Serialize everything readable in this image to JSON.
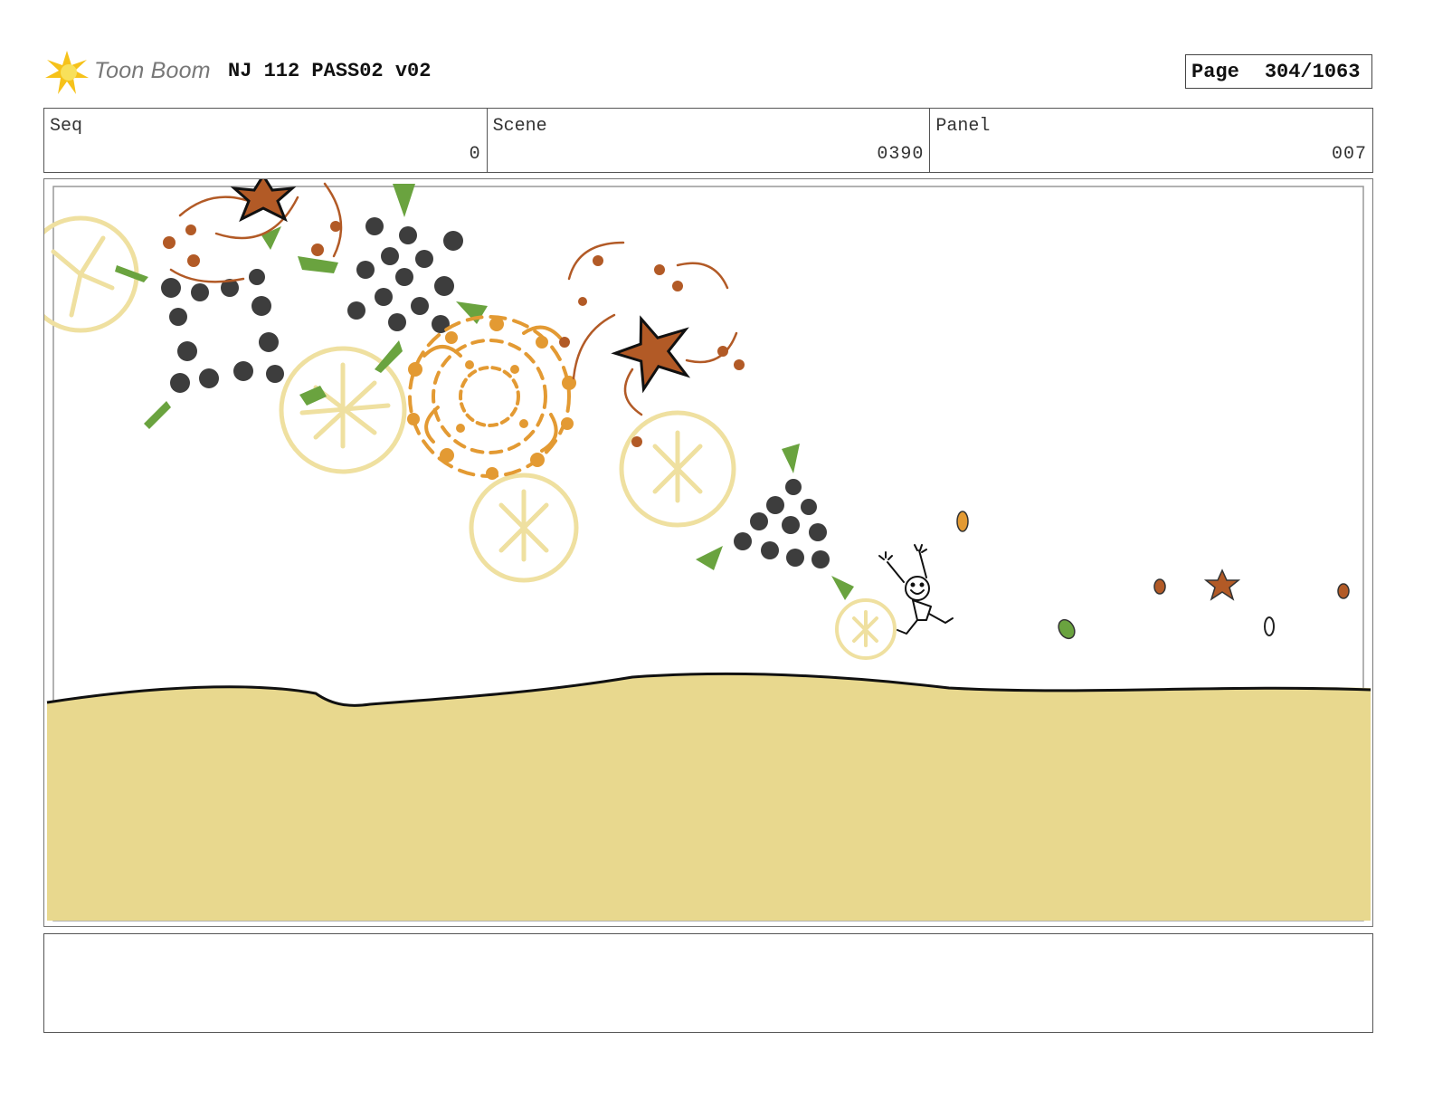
{
  "header": {
    "logo_text": "Toon Boom",
    "doc_title": "NJ 112 PASS02 v02",
    "page_label": "Page",
    "page_value": "304/1063"
  },
  "info": [
    {
      "label": "Seq",
      "value": "0"
    },
    {
      "label": "Scene",
      "value": "0390"
    },
    {
      "label": "Panel",
      "value": "007"
    }
  ],
  "panel": {
    "colors": {
      "sand": "#e8d88e",
      "firework_pale": "#efe0a0",
      "orange": "#e39a33",
      "brown": "#b25a26",
      "green": "#6aa33f",
      "dark": "#3d3d3d"
    }
  },
  "notes": {
    "text": ""
  }
}
